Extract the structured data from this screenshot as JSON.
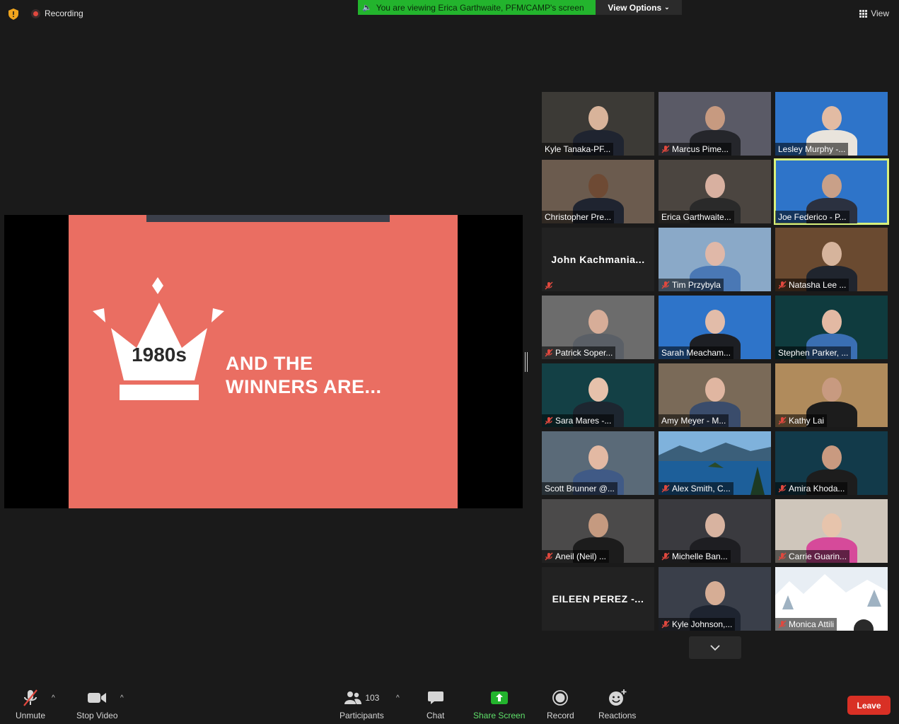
{
  "top": {
    "recording_label": "Recording",
    "viewing_banner": "You are viewing Erica Garthwaite, PFM/CAMP's screen",
    "view_options_label": "View Options",
    "view_label": "View"
  },
  "slide": {
    "crown_text": "1980s",
    "headline_line1": "AND THE",
    "headline_line2": "WINNERS ARE..."
  },
  "participants": [
    {
      "name": "Kyle Tanaka-PF...",
      "muted": false,
      "bg": "#3c3a36",
      "skin": "#d8b39a",
      "shirt": "#1f2430"
    },
    {
      "name": "Marcus Pime...",
      "muted": true,
      "bg": "#5a5a66",
      "skin": "#c79a80",
      "shirt": "#25262b"
    },
    {
      "name": "Lesley Murphy -...",
      "muted": false,
      "bg": "#2e74c9",
      "skin": "#e2bba3",
      "shirt": "#e9e4dc"
    },
    {
      "name": "Christopher Pre...",
      "muted": false,
      "bg": "#6b5b4e",
      "skin": "#6e4a34",
      "shirt": "#1f2430"
    },
    {
      "name": "Erica Garthwaite...",
      "muted": false,
      "bg": "#4b4540",
      "skin": "#d8b0a0",
      "shirt": "#2a2a2a"
    },
    {
      "name": "Joe Federico - P...",
      "muted": false,
      "bg": "#2e74c9",
      "skin": "#c9a088",
      "shirt": "#2b3140",
      "active": true
    },
    {
      "name": "John  Kachmania...",
      "muted": true,
      "text_only": true
    },
    {
      "name": "Tim Przybyla",
      "muted": true,
      "bg": "#8aa9c8",
      "skin": "#e0b8a8",
      "shirt": "#4a78b5"
    },
    {
      "name": "Natasha Lee ...",
      "muted": true,
      "bg": "#6a4a30",
      "skin": "#d6b49c",
      "shirt": "#20252e"
    },
    {
      "name": "Patrick Soper...",
      "muted": true,
      "bg": "#6c6c6c",
      "skin": "#d7ad98",
      "shirt": "#5a5f66"
    },
    {
      "name": "Sarah Meacham...",
      "muted": false,
      "bg": "#2e74c9",
      "skin": "#e2bca9",
      "shirt": "#1d1f24"
    },
    {
      "name": "Stephen Parker, ...",
      "muted": false,
      "bg": "#0f3b3e",
      "skin": "#e3b9a3",
      "shirt": "#3a6fb3"
    },
    {
      "name": "Sara Mares -...",
      "muted": true,
      "bg": "#134045",
      "skin": "#e6c1ab",
      "shirt": "#1d2630"
    },
    {
      "name": "Amy Meyer - M...",
      "muted": false,
      "bg": "#7a6a58",
      "skin": "#e0b6a1",
      "shirt": "#3a4c6b"
    },
    {
      "name": "Kathy Lai",
      "muted": true,
      "bg": "#b08b5c",
      "skin": "#c89a80",
      "shirt": "#1c1c1c"
    },
    {
      "name": "Scott Brunner @...",
      "muted": false,
      "bg": "#5a6a78",
      "skin": "#e3b9a3",
      "shirt": "#405a86"
    },
    {
      "name": "Alex Smith, C...",
      "muted": true,
      "bg": "#2f6fa8",
      "scenery": "lake"
    },
    {
      "name": "Amira Khoda...",
      "muted": true,
      "bg": "#123a4a",
      "skin": "#c99a80",
      "shirt": "#1d1d1d"
    },
    {
      "name": "Aneil (Neil) ...",
      "muted": true,
      "bg": "#4b4a4a",
      "skin": "#c59a80",
      "shirt": "#1c1c1c"
    },
    {
      "name": "Michelle Ban...",
      "muted": true,
      "bg": "#3a3a3f",
      "skin": "#d8b3a0",
      "shirt": "#1e1e22"
    },
    {
      "name": "Carrie Guarin...",
      "muted": true,
      "bg": "#cfc6bb",
      "skin": "#e7c4ac",
      "shirt": "#d64a9a"
    },
    {
      "name": "EILEEN PEREZ -...",
      "muted": false,
      "text_only": true
    },
    {
      "name": "Kyle Johnson,...",
      "muted": true,
      "bg": "#3a3f4a",
      "skin": "#d6ad95",
      "shirt": "#1e2430"
    },
    {
      "name": "Monica Attili",
      "muted": true,
      "bg": "#dfe6ee",
      "scenery": "snow"
    }
  ],
  "toolbar": {
    "unmute": "Unmute",
    "stop_video": "Stop Video",
    "participants": "Participants",
    "participant_count": "103",
    "chat": "Chat",
    "share_screen": "Share Screen",
    "record": "Record",
    "reactions": "Reactions",
    "leave": "Leave"
  },
  "colors": {
    "banner_green": "#23b42d",
    "share_green": "#5fe06a",
    "leave_red": "#d93025",
    "active_speaker": "#d8f07c",
    "slide_bg": "#ea6e62"
  }
}
